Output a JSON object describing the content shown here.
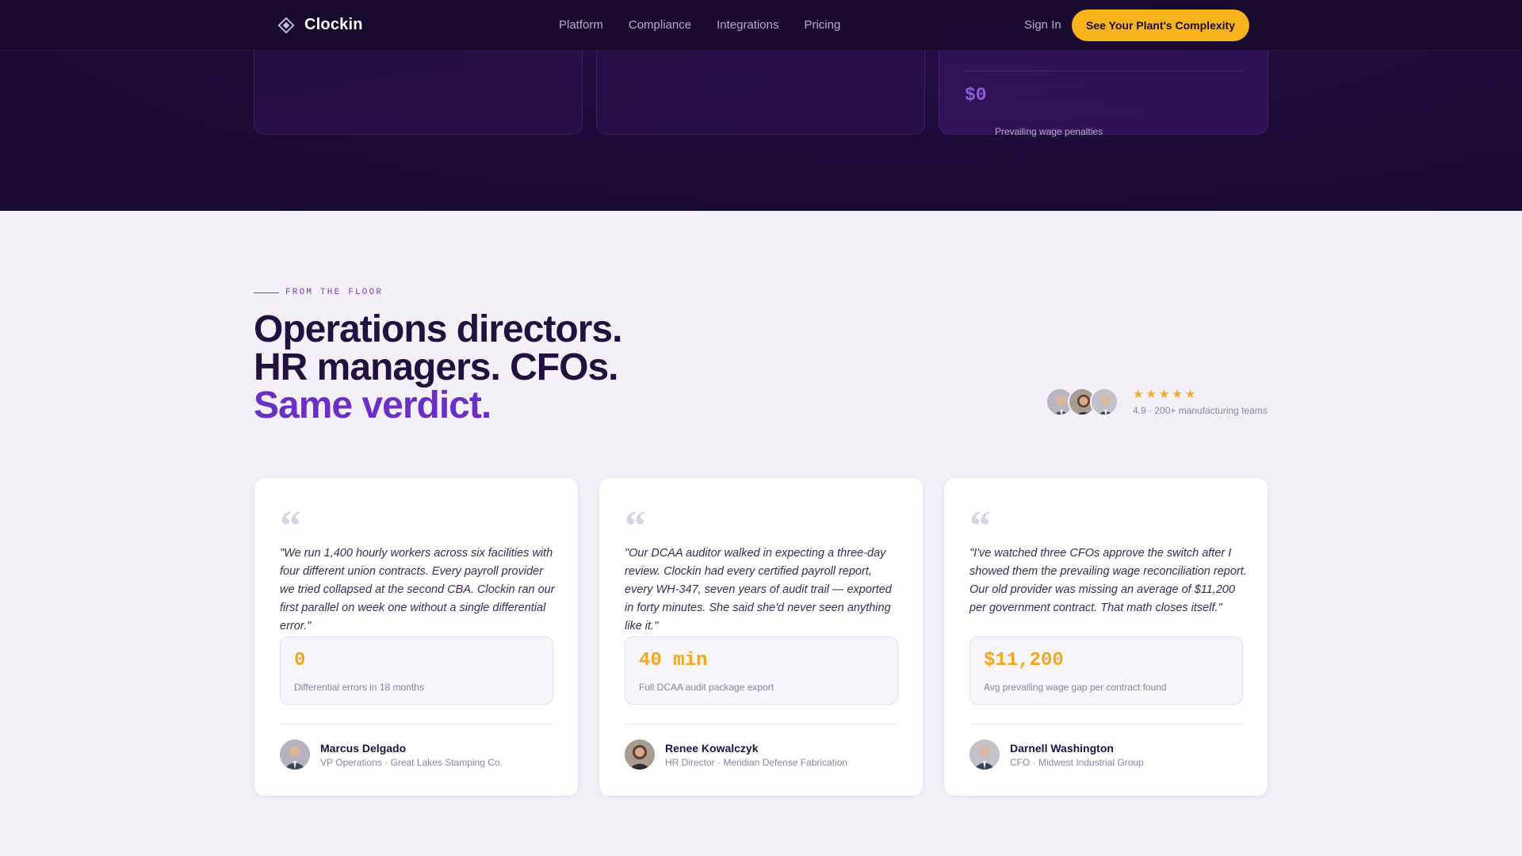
{
  "nav": {
    "brand": "Clockin",
    "links": [
      "Platform",
      "Compliance",
      "Integrations",
      "Pricing"
    ],
    "sign_in": "Sign In",
    "cta": "See Your Plant's Complexity"
  },
  "hero_cards": {
    "penalty_value": "$0",
    "penalty_label": "Prevailing wage penalties"
  },
  "testimonials": {
    "eyebrow": "FROM THE FLOOR",
    "headline_line1": "Operations directors.",
    "headline_line2": "HR managers. CFOs.",
    "headline_accent": "Same verdict.",
    "rating": {
      "stars": "★★★★★",
      "text": "4.9 · 200+ manufacturing teams"
    },
    "quote_mark": "“",
    "cards": [
      {
        "quote": "\"We run 1,400 hourly workers across six facilities with four different union contracts. Every payroll provider we tried collapsed at the second CBA. Clockin ran our first parallel on week one without a single differential error.\"",
        "metric_value": "0",
        "metric_label": "Differential errors in 18 months",
        "name": "Marcus Delgado",
        "role": "VP Operations · Great Lakes Stamping Co."
      },
      {
        "quote": "\"Our DCAA auditor walked in expecting a three-day review. Clockin had every certified payroll report, every WH-347, seven years of audit trail — exported in forty minutes. She said she'd never seen anything like it.\"",
        "metric_value": "40 min",
        "metric_label": "Full DCAA audit package export",
        "name": "Renee Kowalczyk",
        "role": "HR Director · Meridian Defense Fabrication"
      },
      {
        "quote": "\"I've watched three CFOs approve the switch after I showed them the prevailing wage reconciliation report. Our old provider was missing an average of $11,200 per government contract. That math closes itself.\"",
        "metric_value": "$11,200",
        "metric_label": "Avg prevailing wage gap per contract found",
        "name": "Darnell Washington",
        "role": "CFO · Midwest Industrial Group"
      }
    ]
  },
  "colors": {
    "accent_purple": "#6a2fc4",
    "cta_yellow": "#f8b41c",
    "metric_gold": "#f2a81d",
    "dark_bg": "#1d0c38"
  }
}
